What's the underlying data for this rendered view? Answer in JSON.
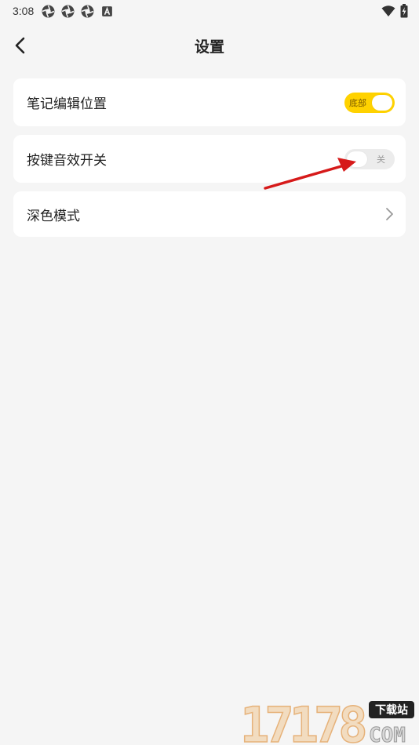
{
  "status_bar": {
    "time": "3:08",
    "icons": [
      "aperture-icon",
      "aperture-icon",
      "aperture-icon",
      "a-badge-icon"
    ],
    "right_icons": [
      "wifi-icon",
      "battery-charging-icon"
    ]
  },
  "header": {
    "title": "设置",
    "back_icon": "chevron-left-icon"
  },
  "settings": [
    {
      "label": "笔记编辑位置",
      "control": "toggle",
      "state": "on",
      "toggle_text": "底部"
    },
    {
      "label": "按键音效开关",
      "control": "toggle",
      "state": "off",
      "toggle_text": "关"
    },
    {
      "label": "深色模式",
      "control": "chevron",
      "icon": "chevron-right-icon"
    }
  ],
  "watermark": {
    "number": "17178",
    "badge": "下载站",
    "domain": "COM"
  },
  "colors": {
    "background": "#f5f5f5",
    "card": "#ffffff",
    "accent": "#ffd200",
    "toggle_off": "#ececec",
    "annotation": "#d61a1a"
  }
}
